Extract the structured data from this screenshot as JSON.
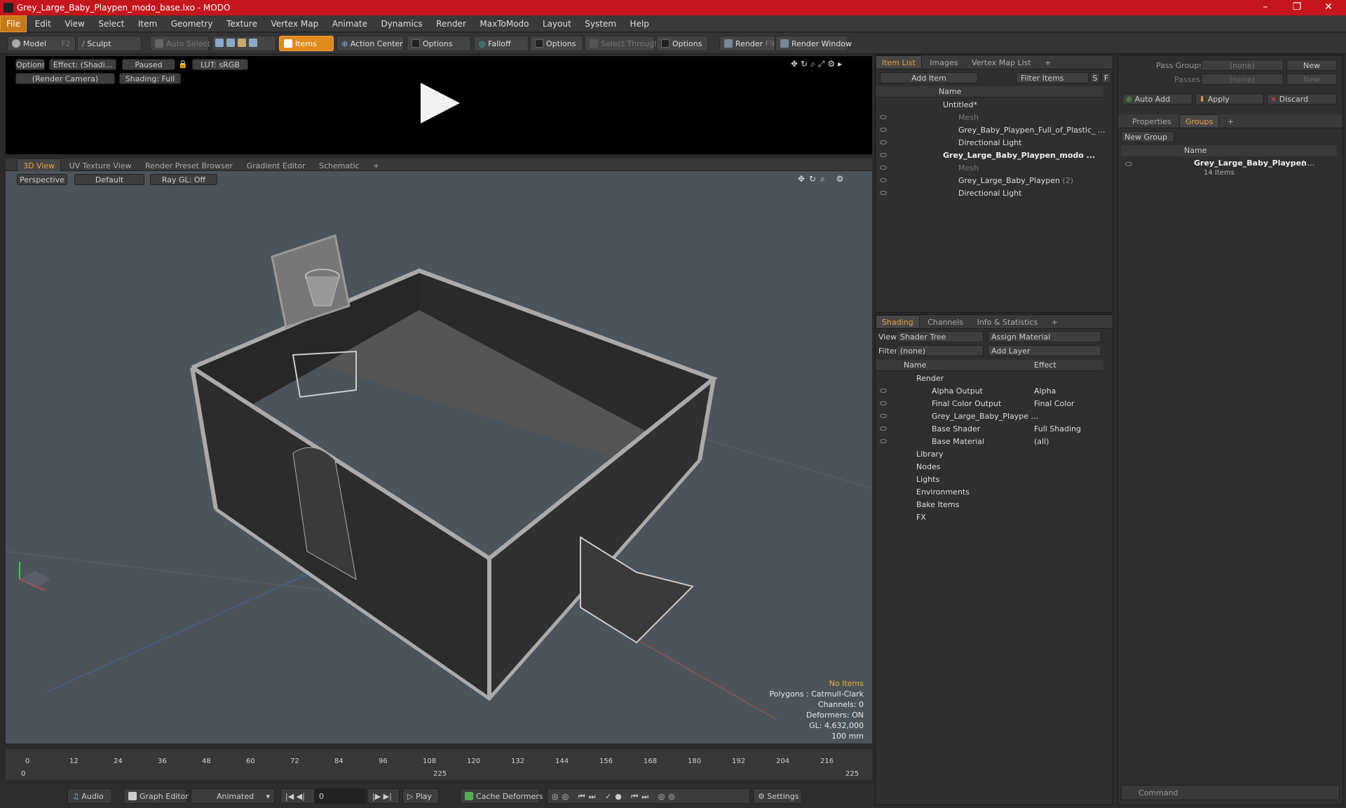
{
  "window": {
    "title": "Grey_Large_Baby_Playpen_modo_base.lxo - MODO"
  },
  "menu": [
    "File",
    "Edit",
    "View",
    "Select",
    "Item",
    "Geometry",
    "Texture",
    "Vertex Map",
    "Animate",
    "Dynamics",
    "Render",
    "MaxToModo",
    "Layout",
    "System",
    "Help"
  ],
  "toolbar": {
    "model": "Model",
    "model_key": "F2",
    "sculpt": "Sculpt",
    "auto_select": "Auto Select",
    "items": "Items",
    "action_center": "Action Center",
    "options1": "Options",
    "falloff": "Falloff",
    "options2": "Options",
    "select_through": "Select Through",
    "options3": "Options",
    "render": "Render",
    "render_key": "F9",
    "render_window": "Render Window"
  },
  "preview": {
    "options": "Options",
    "effect": "Effect: (Shadi...",
    "paused": "Paused",
    "lut": "LUT: sRGB",
    "camera": "(Render Camera)",
    "shading": "Shading: Full"
  },
  "viewport": {
    "tabs": [
      "3D View",
      "UV Texture View",
      "Render Preset Browser",
      "Gradient Editor",
      "Schematic"
    ],
    "perspective": "Perspective",
    "default": "Default",
    "raygl": "Ray GL: Off",
    "status": {
      "no_items": "No Items",
      "polygons": "Polygons : Catmull-Clark",
      "channels": "Channels: 0",
      "deformers": "Deformers: ON",
      "gl": "GL: 4,632,000",
      "scale": "100 mm"
    }
  },
  "timeline": {
    "ticks": [
      "0",
      "12",
      "24",
      "36",
      "48",
      "60",
      "72",
      "84",
      "96",
      "108",
      "120",
      "132",
      "144",
      "156",
      "168",
      "180",
      "192",
      "204",
      "216"
    ],
    "start": "0",
    "mid": "225",
    "end": "225"
  },
  "bottom": {
    "audio": "Audio",
    "graph_editor": "Graph Editor",
    "animated": "Animated",
    "frame": "0",
    "play": "Play",
    "cache": "Cache Deformers",
    "settings": "Settings"
  },
  "itemlist": {
    "tabs": [
      "Item List",
      "Images",
      "Vertex Map List"
    ],
    "add_item": "Add Item",
    "filter": "Filter Items",
    "s": "S",
    "f": "F",
    "col_name": "Name",
    "rows": [
      {
        "label": "Untitled*",
        "muted": false,
        "bold": false,
        "eye": false
      },
      {
        "label": "Mesh",
        "muted": true,
        "bold": false,
        "eye": true
      },
      {
        "label": "Grey_Baby_Playpen_Full_of_Plastic_ ...",
        "muted": false,
        "bold": false,
        "eye": true
      },
      {
        "label": "Directional Light",
        "muted": false,
        "bold": false,
        "eye": true
      },
      {
        "label": "Grey_Large_Baby_Playpen_modo ...",
        "muted": false,
        "bold": true,
        "eye": true
      },
      {
        "label": "Mesh",
        "muted": true,
        "bold": false,
        "eye": true
      },
      {
        "label": "Grey_Large_Baby_Playpen",
        "suffix": "(2)",
        "muted": false,
        "bold": false,
        "eye": true
      },
      {
        "label": "Directional Light",
        "muted": false,
        "bold": false,
        "eye": true
      }
    ]
  },
  "shading": {
    "tabs": [
      "Shading",
      "Channels",
      "Info & Statistics"
    ],
    "view_label": "View",
    "view_value": "Shader Tree",
    "assign": "Assign Material",
    "filter_label": "Filter",
    "filter_value": "(none)",
    "add_layer": "Add Layer",
    "col_name": "Name",
    "col_effect": "Effect",
    "rows": [
      {
        "label": "Render",
        "effect": ""
      },
      {
        "label": "Alpha Output",
        "effect": "Alpha"
      },
      {
        "label": "Final Color Output",
        "effect": "Final Color"
      },
      {
        "label": "Grey_Large_Baby_Plaype ...",
        "effect": ""
      },
      {
        "label": "Base Shader",
        "effect": "Full Shading"
      },
      {
        "label": "Base Material",
        "effect": "(all)"
      },
      {
        "label": "Library",
        "effect": ""
      },
      {
        "label": "Nodes",
        "effect": ""
      },
      {
        "label": "Lights",
        "effect": ""
      },
      {
        "label": "Environments",
        "effect": ""
      },
      {
        "label": "Bake Items",
        "effect": ""
      },
      {
        "label": "FX",
        "effect": ""
      }
    ]
  },
  "groups": {
    "pass_groups": "Pass Groups",
    "passes": "Passes",
    "none1": "(none)",
    "none2": "(none)",
    "new1": "New",
    "new2": "New",
    "auto_add": "Auto Add",
    "apply": "Apply",
    "discard": "Discard",
    "tabs": [
      "Properties",
      "Groups"
    ],
    "new_group": "New Group",
    "col_name": "Name",
    "group_name": "Grey_Large_Baby_Playpen",
    "group_paren": "( ...",
    "group_count": "14 Items"
  },
  "command": {
    "placeholder": "Command"
  }
}
